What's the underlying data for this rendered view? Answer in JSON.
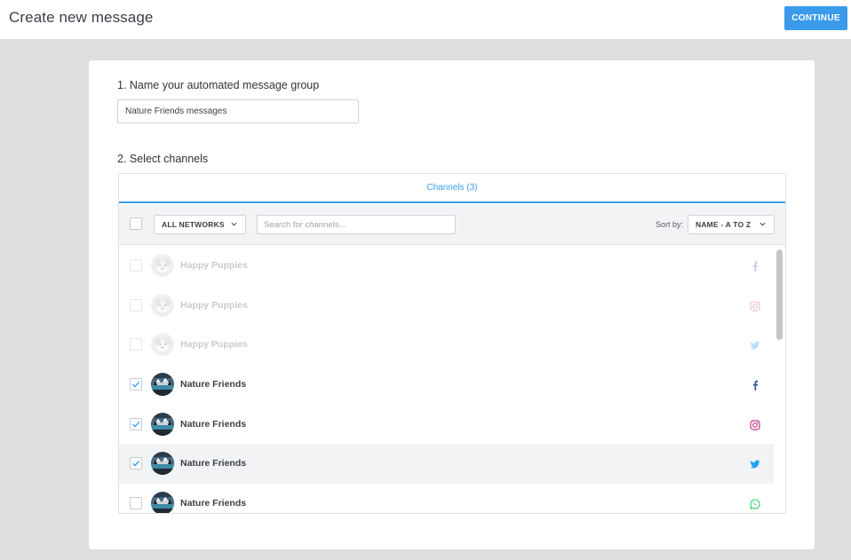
{
  "header": {
    "title": "Create new message",
    "continue_label": "CONTINUE"
  },
  "step1": {
    "label": "1. Name your automated message group",
    "input_value": "Nature Friends messages"
  },
  "step2": {
    "label": "2. Select channels"
  },
  "channels": {
    "tab_label": "Channels (3)",
    "networks_filter": "ALL NETWORKS",
    "search_placeholder": "Search for channels...",
    "sort_label": "Sort by:",
    "sort_value": "NAME - A TO Z",
    "rows": [
      {
        "name": "Happy Puppies",
        "network": "facebook",
        "checked": false,
        "disabled": true
      },
      {
        "name": "Happy Puppies",
        "network": "instagram",
        "checked": false,
        "disabled": true
      },
      {
        "name": "Happy Puppies",
        "network": "twitter",
        "checked": false,
        "disabled": true
      },
      {
        "name": "Nature Friends",
        "network": "facebook",
        "checked": true,
        "disabled": false
      },
      {
        "name": "Nature Friends",
        "network": "instagram",
        "checked": true,
        "disabled": false
      },
      {
        "name": "Nature Friends",
        "network": "twitter",
        "checked": true,
        "disabled": false,
        "highlight": true
      },
      {
        "name": "Nature Friends",
        "network": "whatsapp",
        "checked": false,
        "disabled": false
      }
    ]
  },
  "colors": {
    "accent": "#3a9bea",
    "facebook": "#3b5998",
    "instagram": "#c13584",
    "twitter": "#1da1f2",
    "whatsapp": "#25d366"
  }
}
